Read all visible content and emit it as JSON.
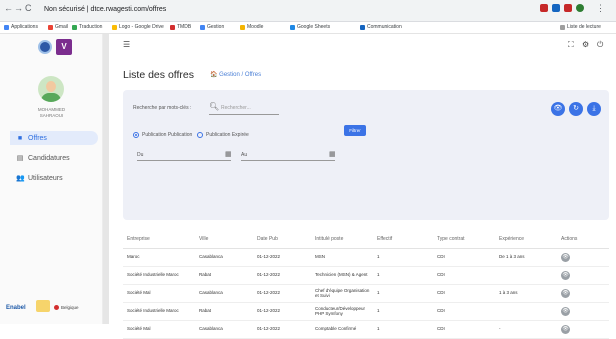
{
  "browser": {
    "nav": [
      "←",
      "→",
      "C"
    ],
    "url": "Non sécurisé | dtce.rwagesti.com/offres",
    "bookmarks": [
      "Applications",
      "Gmail",
      "Traduction",
      "Logo - Google Drive",
      "TMDB",
      "Gestion",
      "Moodle",
      "Google Sheets",
      "Communication",
      "Liste de lecture"
    ]
  },
  "sidebar": {
    "logos": {
      "left_color": "#2d58a6",
      "right_letter": "V",
      "right_color": "#7b2d8e"
    },
    "user_name": "MOHAMMED\nSAHRAOUI",
    "items": [
      {
        "label": "Offres",
        "icon": "briefcase-icon",
        "glyph": "■",
        "active": true
      },
      {
        "label": "Candidatures",
        "icon": "document-icon",
        "glyph": "▤",
        "active": false
      },
      {
        "label": "Utilisateurs",
        "icon": "users-icon",
        "glyph": "👥",
        "active": false
      }
    ],
    "footer": {
      "enabel": "Enabel",
      "partner": "Belgique"
    }
  },
  "topbar": {
    "menu_icon": "☰",
    "icons": [
      "expand-icon",
      "settings-icon",
      "logout-icon"
    ],
    "glyphs": [
      "⛶",
      "⚙",
      "⏻"
    ]
  },
  "page": {
    "title": "Liste des offres",
    "breadcrumb": {
      "home": "🏠",
      "path": "Gestion / Offres"
    }
  },
  "filters": {
    "search_label": "Recherche par mots-clés :",
    "search_placeholder": "Rechercher...",
    "radio_1": "Publication Publication",
    "radio_2": "Publication Expirée",
    "date_from_label": "Du",
    "date_to_label": "Au",
    "filter_button": "Filtrer",
    "action_buttons": [
      "visibility",
      "refresh",
      "download"
    ]
  },
  "colors": {
    "accent": "#3b73e6",
    "panel": "#eef0f7"
  },
  "table": {
    "headers": [
      "Entreprise",
      "Ville",
      "Date Pub",
      "Intitulé poste",
      "Effectif",
      "Type contrat",
      "Expérience",
      "Actions"
    ],
    "rows": [
      [
        "Maroc",
        "Casablanca",
        "01-12-2022",
        "MSN",
        "1",
        "CDI",
        "De 1 à 3 ans",
        ""
      ],
      [
        "Société Industrielle Maroc",
        "Rabat",
        "01-12-2022",
        "Technicien (MSN) & Agent",
        "1",
        "CDI",
        "",
        ""
      ],
      [
        "Société Mal",
        "Casablanca",
        "01-12-2022",
        "Chef d'équipe Organisation et Suivi",
        "1",
        "CDI",
        "1 à 3 ans",
        ""
      ],
      [
        "Société Industrielle Maroc",
        "Rabat",
        "01-12-2022",
        "Conducteur/Développeur PHP Symfony",
        "1",
        "CDI",
        "",
        ""
      ],
      [
        "Société Mal",
        "Casablanca",
        "01-12-2022",
        "Comptable Confirmé",
        "1",
        "CDI",
        "-",
        ""
      ]
    ]
  }
}
